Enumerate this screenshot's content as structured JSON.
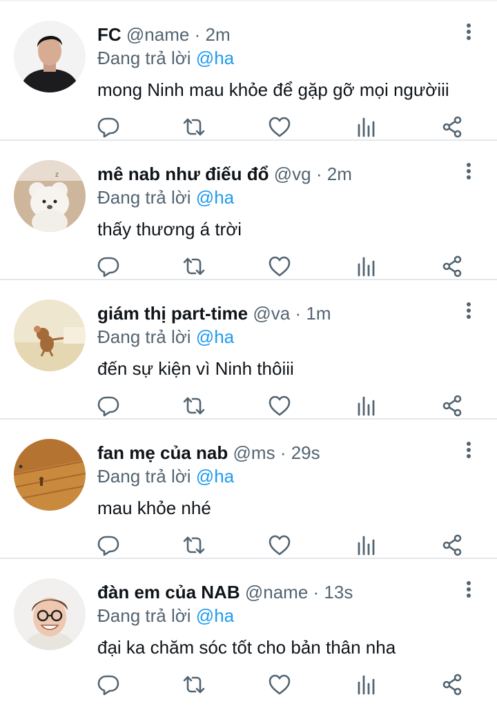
{
  "tweets": [
    {
      "name": "FC",
      "handle": "@name",
      "dot": "·",
      "time": "2m",
      "reply_prefix": "Đang trả lời",
      "reply_to": "@ha",
      "text": "mong Ninh mau khỏe để gặp gỡ mọi ngườiii",
      "avatar": "man-black-sweater-avatar"
    },
    {
      "name": "mê nab như điếu đổ",
      "handle": "@vg",
      "dot": "·",
      "time": "2m",
      "reply_prefix": "Đang trả lời",
      "reply_to": "@ha",
      "text": "thấy thương á trời",
      "avatar": "white-bear-plush-avatar"
    },
    {
      "name": "giám thị part-time",
      "handle": "@va",
      "dot": "·",
      "time": "1m",
      "reply_prefix": "Đang trả lời",
      "reply_to": "@ha",
      "text": "đến sự kiện vì Ninh thôiii",
      "avatar": "cartoon-mouse-avatar"
    },
    {
      "name": "fan mẹ của nab",
      "handle": "@ms",
      "dot": "·",
      "time": "29s",
      "reply_prefix": "Đang trả lời",
      "reply_to": "@ha",
      "text": "mau khỏe nhé",
      "avatar": "wooden-floor-avatar"
    },
    {
      "name": "đàn em của NAB",
      "handle": "@name",
      "dot": "·",
      "time": "13s",
      "reply_prefix": "Đang trả lời",
      "reply_to": "@ha",
      "text": "đại ka chăm sóc tốt cho bản thân nha",
      "avatar": "smiling-man-glasses-avatar"
    }
  ],
  "icons": {
    "reply": "reply-icon",
    "retweet": "retweet-icon",
    "like": "heart-icon",
    "views": "views-icon",
    "share": "share-icon",
    "more": "more-vertical-icon"
  },
  "colors": {
    "text": "#0f1419",
    "secondary": "#536471",
    "accent": "#1d9bf0",
    "divider": "#e4e7ea"
  }
}
